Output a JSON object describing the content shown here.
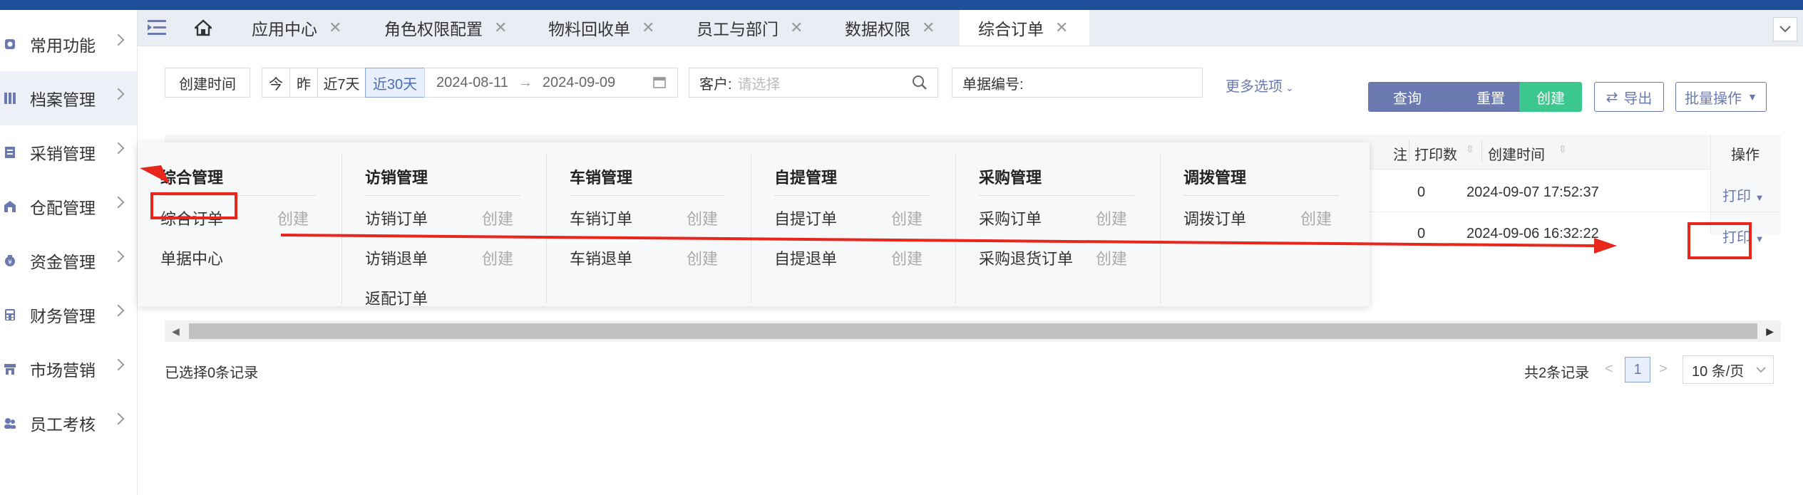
{
  "sidebar": {
    "items": [
      {
        "label": "常用功能",
        "icon": "gear-icon"
      },
      {
        "label": "档案管理",
        "icon": "grid-icon"
      },
      {
        "label": "采销管理",
        "icon": "document-icon"
      },
      {
        "label": "仓配管理",
        "icon": "warehouse-icon"
      },
      {
        "label": "资金管理",
        "icon": "money-bag-icon"
      },
      {
        "label": "财务管理",
        "icon": "calculator-icon"
      },
      {
        "label": "市场营销",
        "icon": "shop-icon"
      },
      {
        "label": "员工考核",
        "icon": "users-icon"
      }
    ]
  },
  "tabs": [
    {
      "label": "应用中心"
    },
    {
      "label": "角色权限配置"
    },
    {
      "label": "物料回收单"
    },
    {
      "label": "员工与部门"
    },
    {
      "label": "数据权限"
    },
    {
      "label": "综合订单"
    }
  ],
  "filters": {
    "create_time_label": "创建时间",
    "today": "今",
    "yesterday": "昨",
    "last7": "近7天",
    "last30": "近30天",
    "date_from": "2024-08-11",
    "date_sep": "→",
    "date_to": "2024-09-09",
    "customer_label": "客户:",
    "customer_placeholder": "请选择",
    "order_no_label": "单据编号:",
    "more_options": "更多选项"
  },
  "actions": {
    "query": "查询",
    "reset": "重置",
    "create": "创建",
    "export": "导出",
    "batch": "批量操作"
  },
  "colors": {
    "query": "#6a7ab0",
    "reset": "#6a7ab0",
    "create": "#3cc78f",
    "accent": "#1f4e9a",
    "annotation": "#e8261c"
  },
  "table": {
    "headers": {
      "remark": "注",
      "print_count": "打印数",
      "created_at": "创建时间",
      "ops": "操作"
    },
    "rows": [
      {
        "print_count": "0",
        "created_at": "2024-09-07 17:52:37",
        "op": "打印"
      },
      {
        "print_count": "0",
        "created_at": "2024-09-06 16:32:22",
        "op": "打印"
      }
    ]
  },
  "menu": {
    "columns": [
      {
        "title": "综合管理",
        "items": [
          {
            "label": "综合订单",
            "create": "创建"
          },
          {
            "label": "单据中心",
            "create": ""
          }
        ]
      },
      {
        "title": "访销管理",
        "items": [
          {
            "label": "访销订单",
            "create": "创建"
          },
          {
            "label": "访销退单",
            "create": "创建"
          },
          {
            "label": "返配订单",
            "create": ""
          }
        ]
      },
      {
        "title": "车销管理",
        "items": [
          {
            "label": "车销订单",
            "create": "创建"
          },
          {
            "label": "车销退单",
            "create": "创建"
          }
        ]
      },
      {
        "title": "自提管理",
        "items": [
          {
            "label": "自提订单",
            "create": "创建"
          },
          {
            "label": "自提退单",
            "create": "创建"
          }
        ]
      },
      {
        "title": "采购管理",
        "items": [
          {
            "label": "采购订单",
            "create": "创建"
          },
          {
            "label": "采购退货订单",
            "create": "创建"
          }
        ]
      },
      {
        "title": "调拨管理",
        "items": [
          {
            "label": "调拨订单",
            "create": "创建"
          }
        ]
      }
    ]
  },
  "footer": {
    "selected": "已选择0条记录",
    "total": "共2条记录",
    "page": "1",
    "page_size": "10 条/页"
  }
}
